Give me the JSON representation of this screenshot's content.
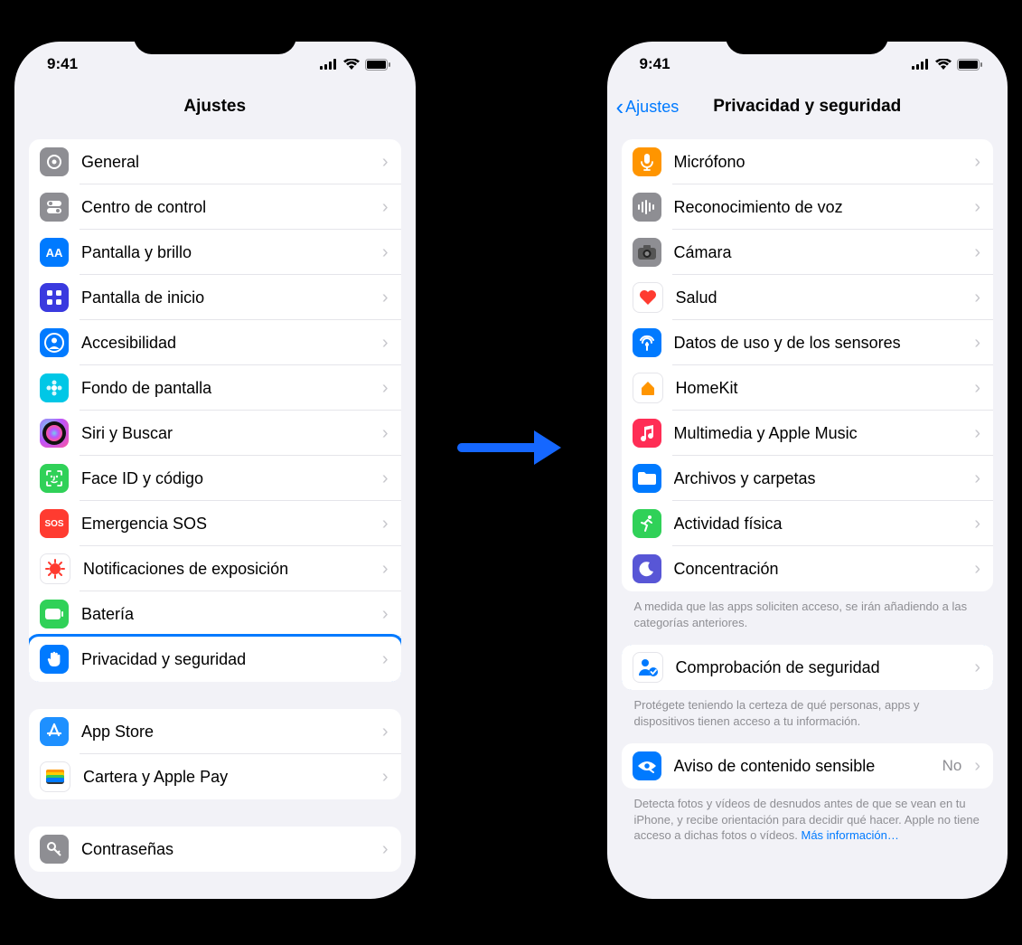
{
  "status": {
    "time": "9:41"
  },
  "left": {
    "title": "Ajustes",
    "group1": [
      {
        "id": "general",
        "label": "General",
        "bg": "#8e8e93",
        "icon": "gear"
      },
      {
        "id": "control",
        "label": "Centro de control",
        "bg": "#8e8e93",
        "icon": "toggles"
      },
      {
        "id": "display",
        "label": "Pantalla y brillo",
        "bg": "#007aff",
        "icon": "AA",
        "text": true
      },
      {
        "id": "home",
        "label": "Pantalla de inicio",
        "bg": "#3a3adf",
        "icon": "grid"
      },
      {
        "id": "accessibility",
        "label": "Accesibilidad",
        "bg": "#007aff",
        "icon": "person-circle"
      },
      {
        "id": "wallpaper",
        "label": "Fondo de pantalla",
        "bg": "#00c7e6",
        "icon": "flower"
      },
      {
        "id": "siri",
        "label": "Siri y Buscar",
        "bg": "grad",
        "icon": "siri"
      },
      {
        "id": "faceid",
        "label": "Face ID y código",
        "bg": "#30d158",
        "icon": "faceid"
      },
      {
        "id": "sos",
        "label": "Emergencia SOS",
        "bg": "#ff3b30",
        "icon": "SOS",
        "text": true
      },
      {
        "id": "exposure",
        "label": "Notificaciones de exposición",
        "bg": "#ffffff",
        "icon": "virus",
        "fg": "#ff3b30"
      },
      {
        "id": "battery",
        "label": "Batería",
        "bg": "#30d158",
        "icon": "battery"
      },
      {
        "id": "privacy",
        "label": "Privacidad y seguridad",
        "bg": "#007aff",
        "icon": "hand",
        "highlight": true
      }
    ],
    "group2": [
      {
        "id": "appstore",
        "label": "App Store",
        "bg": "#1e90ff",
        "icon": "appstore"
      },
      {
        "id": "wallet",
        "label": "Cartera y Apple Pay",
        "bg": "#ffffff",
        "icon": "wallet"
      }
    ],
    "group3": [
      {
        "id": "passwords",
        "label": "Contraseñas",
        "bg": "#8e8e93",
        "icon": "key"
      }
    ]
  },
  "right": {
    "back": "Ajustes",
    "title": "Privacidad y seguridad",
    "group1": [
      {
        "id": "mic",
        "label": "Micrófono",
        "bg": "#ff9500",
        "icon": "mic"
      },
      {
        "id": "speech",
        "label": "Reconocimiento de voz",
        "bg": "#8e8e93",
        "icon": "waveform"
      },
      {
        "id": "camera",
        "label": "Cámara",
        "bg": "#8e8e93",
        "icon": "camera"
      },
      {
        "id": "health",
        "label": "Salud",
        "bg": "#ffffff",
        "icon": "heart",
        "fg": "#ff3b30"
      },
      {
        "id": "sensors",
        "label": "Datos de uso y de los sensores",
        "bg": "#007aff",
        "icon": "sensors"
      },
      {
        "id": "homekit",
        "label": "HomeKit",
        "bg": "#ffffff",
        "icon": "home",
        "fg": "#ff9500"
      },
      {
        "id": "media",
        "label": "Multimedia y Apple Music",
        "bg": "#ff2d55",
        "icon": "music"
      },
      {
        "id": "files",
        "label": "Archivos y carpetas",
        "bg": "#007aff",
        "icon": "folder"
      },
      {
        "id": "fitness",
        "label": "Actividad física",
        "bg": "#30d158",
        "icon": "running"
      },
      {
        "id": "focus",
        "label": "Concentración",
        "bg": "#5856d6",
        "icon": "moon"
      }
    ],
    "footer1": "A medida que las apps soliciten acceso, se irán añadiendo a las categorías anteriores.",
    "group2": [
      {
        "id": "safetycheck",
        "label": "Comprobación de seguridad",
        "bg": "#ffffff",
        "icon": "safetycheck",
        "fg": "#007aff",
        "highlight": true
      }
    ],
    "footer2": "Protégete teniendo la certeza de qué personas, apps y dispositivos tienen acceso a tu información.",
    "group3": [
      {
        "id": "sensitive",
        "label": "Aviso de contenido sensible",
        "bg": "#007aff",
        "icon": "eye",
        "value": "No"
      }
    ],
    "footer3": "Detecta fotos y vídeos de desnudos antes de que se vean en tu iPhone, y recibe orientación para decidir qué hacer. Apple no tiene acceso a dichas fotos o vídeos. ",
    "footer3link": "Más información…"
  }
}
